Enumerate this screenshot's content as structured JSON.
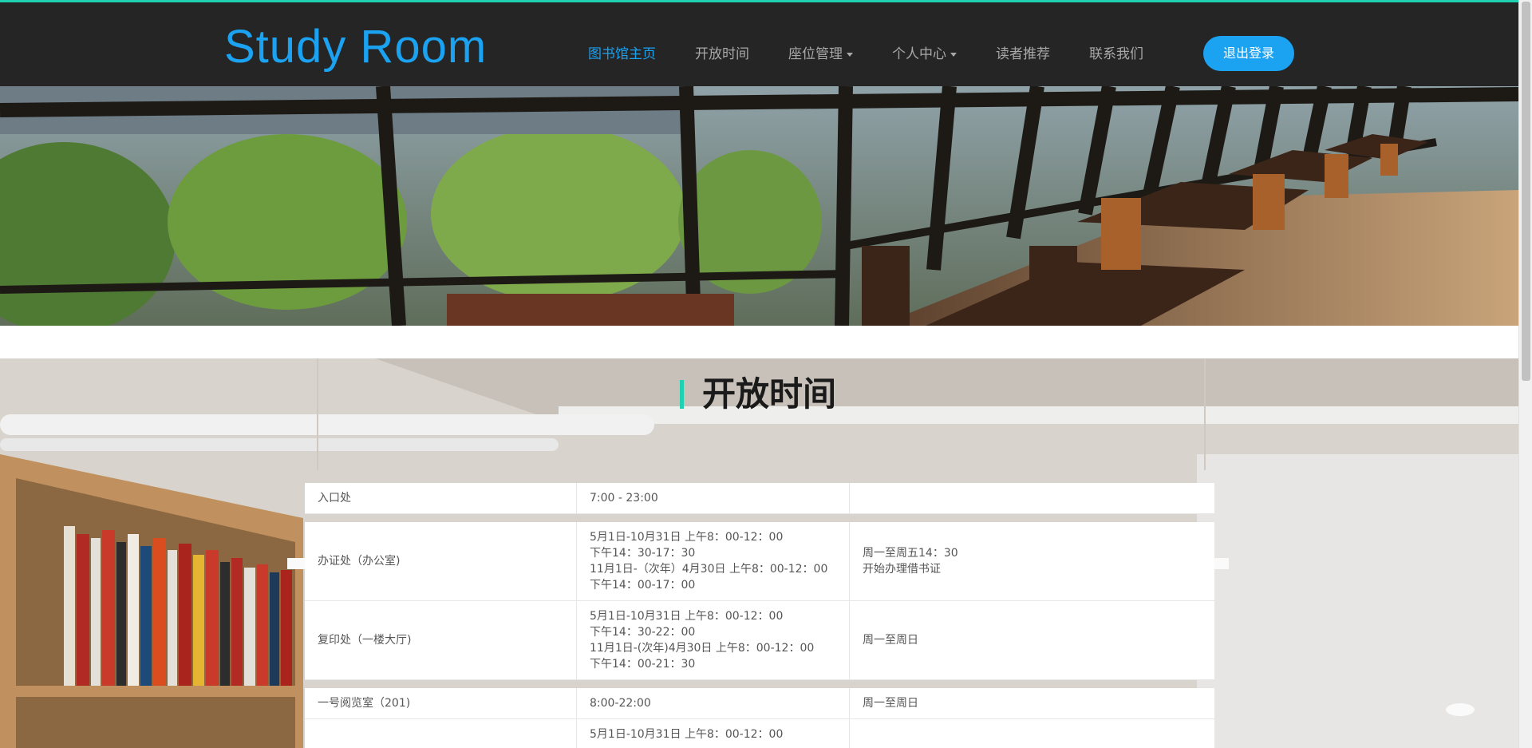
{
  "brand": "Study Room",
  "nav": {
    "items": [
      {
        "label": "图书馆主页",
        "active": true,
        "dropdown": false
      },
      {
        "label": "开放时间",
        "active": false,
        "dropdown": false
      },
      {
        "label": "座位管理",
        "active": false,
        "dropdown": true
      },
      {
        "label": "个人中心",
        "active": false,
        "dropdown": true
      },
      {
        "label": "读者推荐",
        "active": false,
        "dropdown": false
      },
      {
        "label": "联系我们",
        "active": false,
        "dropdown": false
      }
    ],
    "logout": "退出登录"
  },
  "section": {
    "title": "开放时间"
  },
  "hours": [
    {
      "place": "入口处",
      "time": [
        "7:00 - 23:00"
      ],
      "days": []
    },
    {
      "place": "办证处（办公室)",
      "time": [
        "5月1日-10月31日 上午8：00-12：00",
        "下午14：30-17：30",
        "11月1日-（次年）4月30日 上午8：00-12：00",
        "下午14：00-17：00"
      ],
      "days": [
        "周一至周五14：30",
        "开始办理借书证"
      ]
    },
    {
      "place": "复印处（一楼大厅)",
      "time": [
        "5月1日-10月31日 上午8：00-12：00",
        "下午14：30-22：00",
        "11月1日-(次年)4月30日 上午8：00-12：00",
        "下午14：00-21：30"
      ],
      "days": [
        "周一至周日"
      ]
    },
    {
      "place": "一号阅览室（201)",
      "time": [
        "8:00-22:00"
      ],
      "days": [
        "周一至周日"
      ]
    },
    {
      "place": "",
      "time": [
        "5月1日-10月31日 上午8：00-12：00"
      ],
      "days": []
    }
  ],
  "colors": {
    "accent": "#1ba2f1",
    "teal": "#1fd1b1",
    "navbar": "#252525"
  }
}
